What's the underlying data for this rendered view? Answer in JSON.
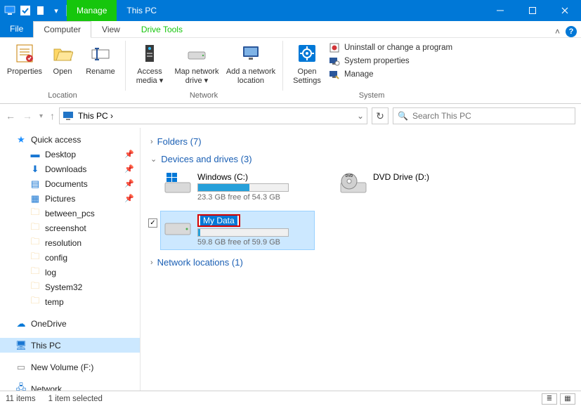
{
  "window": {
    "app_icon": "pc",
    "manage_tab": "Manage",
    "title": "This PC"
  },
  "tabs": {
    "file": "File",
    "computer": "Computer",
    "view": "View",
    "drivetools": "Drive Tools"
  },
  "ribbon": {
    "location": {
      "properties": "Properties",
      "open": "Open",
      "rename": "Rename",
      "label": "Location"
    },
    "network": {
      "access_media": "Access media ▾",
      "map_drive": "Map network drive ▾",
      "add_location": "Add a network location",
      "label": "Network"
    },
    "system": {
      "open_settings": "Open Settings",
      "uninstall": "Uninstall or change a program",
      "sysprops": "System properties",
      "manage": "Manage",
      "label": "System"
    }
  },
  "addressbar": {
    "path": "This PC ›"
  },
  "search": {
    "placeholder": "Search This PC"
  },
  "sidebar": {
    "quick_access": "Quick access",
    "desktop": "Desktop",
    "downloads": "Downloads",
    "documents": "Documents",
    "pictures": "Pictures",
    "between_pcs": "between_pcs",
    "screenshot": "screenshot",
    "resolution": "resolution",
    "config": "config",
    "log": "log",
    "system32": "System32",
    "temp": "temp",
    "onedrive": "OneDrive",
    "this_pc": "This PC",
    "new_volume": "New Volume (F:)",
    "network": "Network"
  },
  "content": {
    "folders_header": "Folders (7)",
    "devices_header": "Devices and drives (3)",
    "netloc_header": "Network locations (1)",
    "drives": {
      "c": {
        "name": "Windows (C:)",
        "free": "23.3 GB free of 54.3 GB",
        "fill_pct": 57
      },
      "d": {
        "name": "DVD Drive (D:)"
      },
      "e": {
        "name": "My Data",
        "free": "59.8 GB free of 59.9 GB",
        "fill_pct": 2
      }
    }
  },
  "statusbar": {
    "count": "11 items",
    "selected": "1 item selected"
  }
}
